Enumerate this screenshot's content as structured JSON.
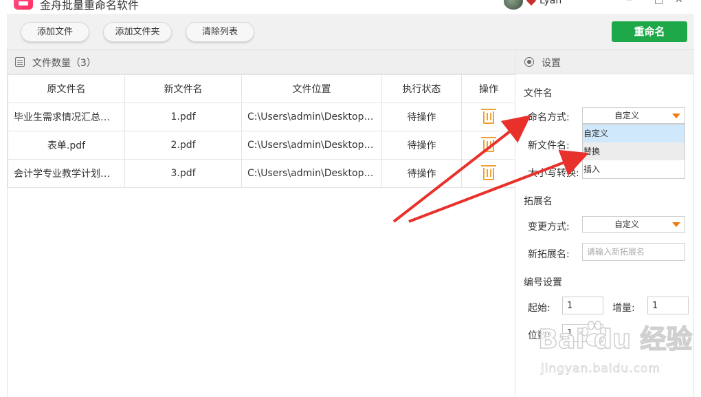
{
  "app": {
    "title": "金舟批量重命名软件",
    "username": "Lyan",
    "win_min": "−",
    "win_max": "□",
    "win_close": "✕"
  },
  "toolbar": {
    "add_file": "添加文件",
    "add_folder": "添加文件夹",
    "clear_list": "清除列表",
    "rename": "重命名"
  },
  "file_panel": {
    "title": "文件数量（3）",
    "columns": [
      "原文件名",
      "新文件名",
      "文件位置",
      "执行状态",
      "操作"
    ],
    "rows": [
      {
        "original": "毕业生需求情况汇总表...",
        "new": "1.pdf",
        "location": "C:\\Users\\admin\\Desktop\\...",
        "status": "待操作"
      },
      {
        "original": "表单.pdf",
        "new": "2.pdf",
        "location": "C:\\Users\\admin\\Desktop\\...",
        "status": "待操作"
      },
      {
        "original": "会计学专业教学计划进...",
        "new": "3.pdf",
        "location": "C:\\Users\\admin\\Desktop\\...",
        "status": "待操作"
      }
    ]
  },
  "settings": {
    "title": "设置",
    "filename": {
      "section": "文件名",
      "mode_label": "命名方式:",
      "mode_value": "自定义",
      "new_name_label": "新文件名:",
      "case_label": "大小写转换:",
      "options": [
        "自定义",
        "替换",
        "插入"
      ]
    },
    "extension": {
      "section": "拓展名",
      "mode_label": "变更方式:",
      "mode_value": "自定义",
      "new_ext_label": "新拓展名:",
      "new_ext_placeholder": "请输入新拓展名"
    },
    "numbering": {
      "section": "编号设置",
      "start_label": "起始:",
      "start_value": "1",
      "step_label": "增量:",
      "step_value": "1",
      "digits_label": "位数:",
      "digits_value": "1"
    }
  },
  "watermark": {
    "main": "Bai  du 经验",
    "sub": "jingyan.baidu.com"
  },
  "colors": {
    "accent_green": "#1fa84a",
    "trash_orange": "#f0a030",
    "arrow_red": "#e8312a",
    "selected_option": "#cfe8fb"
  }
}
